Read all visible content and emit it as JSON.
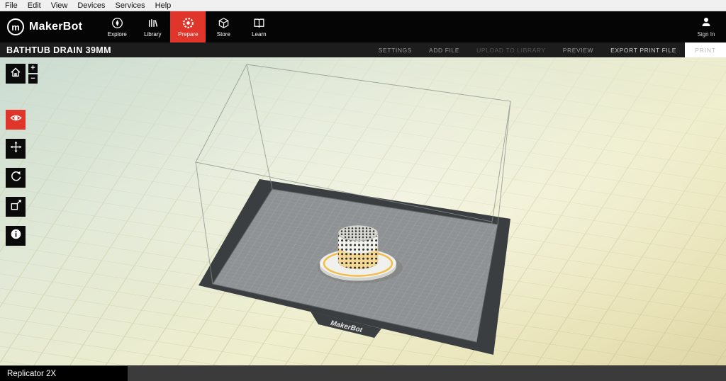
{
  "menubar": {
    "items": [
      "File",
      "Edit",
      "View",
      "Devices",
      "Services",
      "Help"
    ]
  },
  "toolbar": {
    "brand": "MakerBot",
    "logo_letter": "m",
    "nav": [
      {
        "label": "Explore",
        "active": false
      },
      {
        "label": "Library",
        "active": false
      },
      {
        "label": "Prepare",
        "active": true
      },
      {
        "label": "Store",
        "active": false
      },
      {
        "label": "Learn",
        "active": false
      }
    ],
    "sign_in": "Sign In"
  },
  "titlebar": {
    "title": "BATHTUB DRAIN 39MM",
    "actions": [
      {
        "label": "SETTINGS",
        "enabled": true
      },
      {
        "label": "ADD FILE",
        "enabled": true
      },
      {
        "label": "UPLOAD TO LIBRARY",
        "enabled": false
      },
      {
        "label": "PREVIEW",
        "enabled": true
      },
      {
        "label": "EXPORT PRINT FILE",
        "enabled": true
      }
    ],
    "print_label": "PRINT"
  },
  "view_tools": {
    "zoom_in": "+",
    "zoom_out": "−"
  },
  "scene": {
    "plate_brand": "MakerBot"
  },
  "statusbar": {
    "device": "Replicator 2X"
  },
  "colors": {
    "accent_red": "#e0352b",
    "plate_dark": "#3b3e40",
    "plate_surface": "#8f9294",
    "object_accent": "#f3b73c"
  }
}
